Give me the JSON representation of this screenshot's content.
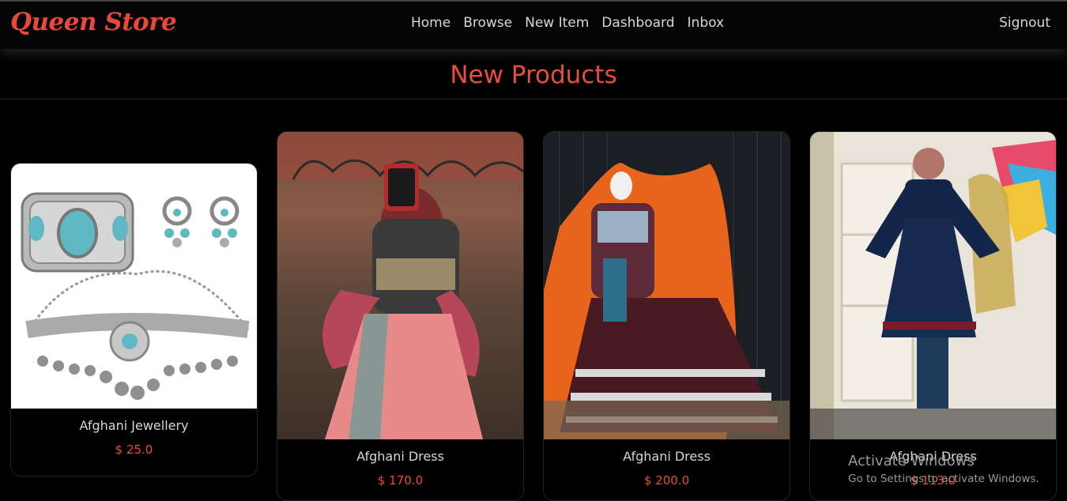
{
  "brand": "Queen Store",
  "nav": [
    "Home",
    "Browse",
    "New Item",
    "Dashboard",
    "Inbox"
  ],
  "signout": "Signout",
  "page_title": "New Products",
  "products": [
    {
      "name": "Afghani Jewellery",
      "price": "$ 25.0"
    },
    {
      "name": "Afghani Dress",
      "price": "$ 170.0"
    },
    {
      "name": "Afghani Dress",
      "price": "$ 200.0"
    },
    {
      "name": "Afghani Dress",
      "price": "$ 113.0"
    }
  ],
  "watermark": {
    "title": "Activate Windows",
    "subtitle": "Go to Settings to activate Windows."
  },
  "colors": {
    "accent": "#e8473a",
    "background": "#000000",
    "text": "#d8d8d8"
  }
}
